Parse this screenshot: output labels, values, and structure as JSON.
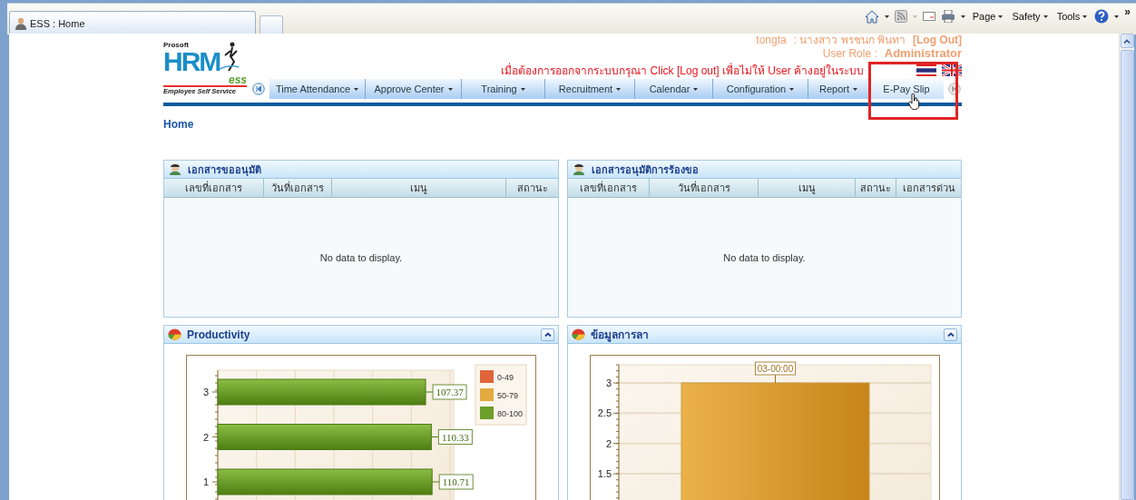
{
  "browser": {
    "tabs": [
      {
        "title": "ESS : Home",
        "selected": true
      }
    ],
    "menus": [
      {
        "label": "Page",
        "dropdown": true
      },
      {
        "label": "Safety",
        "dropdown": true
      },
      {
        "label": "Tools",
        "dropdown": true
      }
    ],
    "overflow": "»"
  },
  "header": {
    "brand_top": "Prosoft",
    "brand_main": "HRM",
    "brand_sub": "ess",
    "brand_tagline": "Employee Self Service",
    "user": "tongta",
    "user_name": ": นางสาว พรชนก พินทา",
    "logout": "[Log Out]",
    "role_label": "User Role :",
    "role": "Administrator",
    "notice": "เมื่อต้องการออกจากระบบกรุณา Click [Log out] เพื่อไม่ให้ User ค้างอยู่ในระบบ"
  },
  "nav": [
    {
      "label": "Time Attendance",
      "dropdown": true,
      "selected": false
    },
    {
      "label": "Approve Center",
      "dropdown": true,
      "selected": false
    },
    {
      "label": "Training",
      "dropdown": true,
      "selected": false
    },
    {
      "label": "Recruitment",
      "dropdown": true,
      "selected": false
    },
    {
      "label": "Calendar",
      "dropdown": true,
      "selected": false
    },
    {
      "label": "Configuration",
      "dropdown": true,
      "selected": false
    },
    {
      "label": "Report",
      "dropdown": true,
      "selected": false
    },
    {
      "label": "E-Pay Slip",
      "dropdown": false,
      "selected": true
    }
  ],
  "breadcrumb": "Home",
  "panels": [
    {
      "kind": "table",
      "title": "เอกสารขออนุมัติ",
      "columns": [
        "เลขที่เอกสาร",
        "วันที่เอกสาร",
        "เมนู",
        "สถานะ"
      ],
      "empty_text": "No data to display."
    },
    {
      "kind": "table",
      "title": "เอกสารอนุมัติการร้องขอ",
      "columns": [
        "เลขที่เอกสาร",
        "วันที่เอกสาร",
        "เมนู",
        "สถานะ",
        "เอกสารด่วน"
      ],
      "empty_text": "No data to display."
    },
    {
      "kind": "chart",
      "title": "Productivity",
      "legend": [
        {
          "label": "0-49",
          "color": "#e0653a"
        },
        {
          "label": "50-79",
          "color": "#e2aa40"
        },
        {
          "label": "80-100",
          "color": "#6c9f2a"
        }
      ],
      "chart_data": {
        "type": "bar",
        "orientation": "horizontal",
        "categories": [
          "3",
          "2",
          "1"
        ],
        "xlim": [
          0,
          120
        ],
        "grid": true,
        "values": [
          107.37,
          110.33,
          110.71
        ],
        "value_labels": [
          "107.37",
          "110.33",
          "110.71"
        ]
      }
    },
    {
      "kind": "chart",
      "title": "ข้อมูลการลา",
      "chart_data": {
        "type": "bar",
        "orientation": "vertical",
        "values": [
          3
        ],
        "value_labels": [
          "03-00:00"
        ],
        "ylim": [
          0,
          3.3
        ],
        "yticks": [
          1.5,
          2,
          2.5,
          3
        ],
        "grid": true
      }
    }
  ]
}
